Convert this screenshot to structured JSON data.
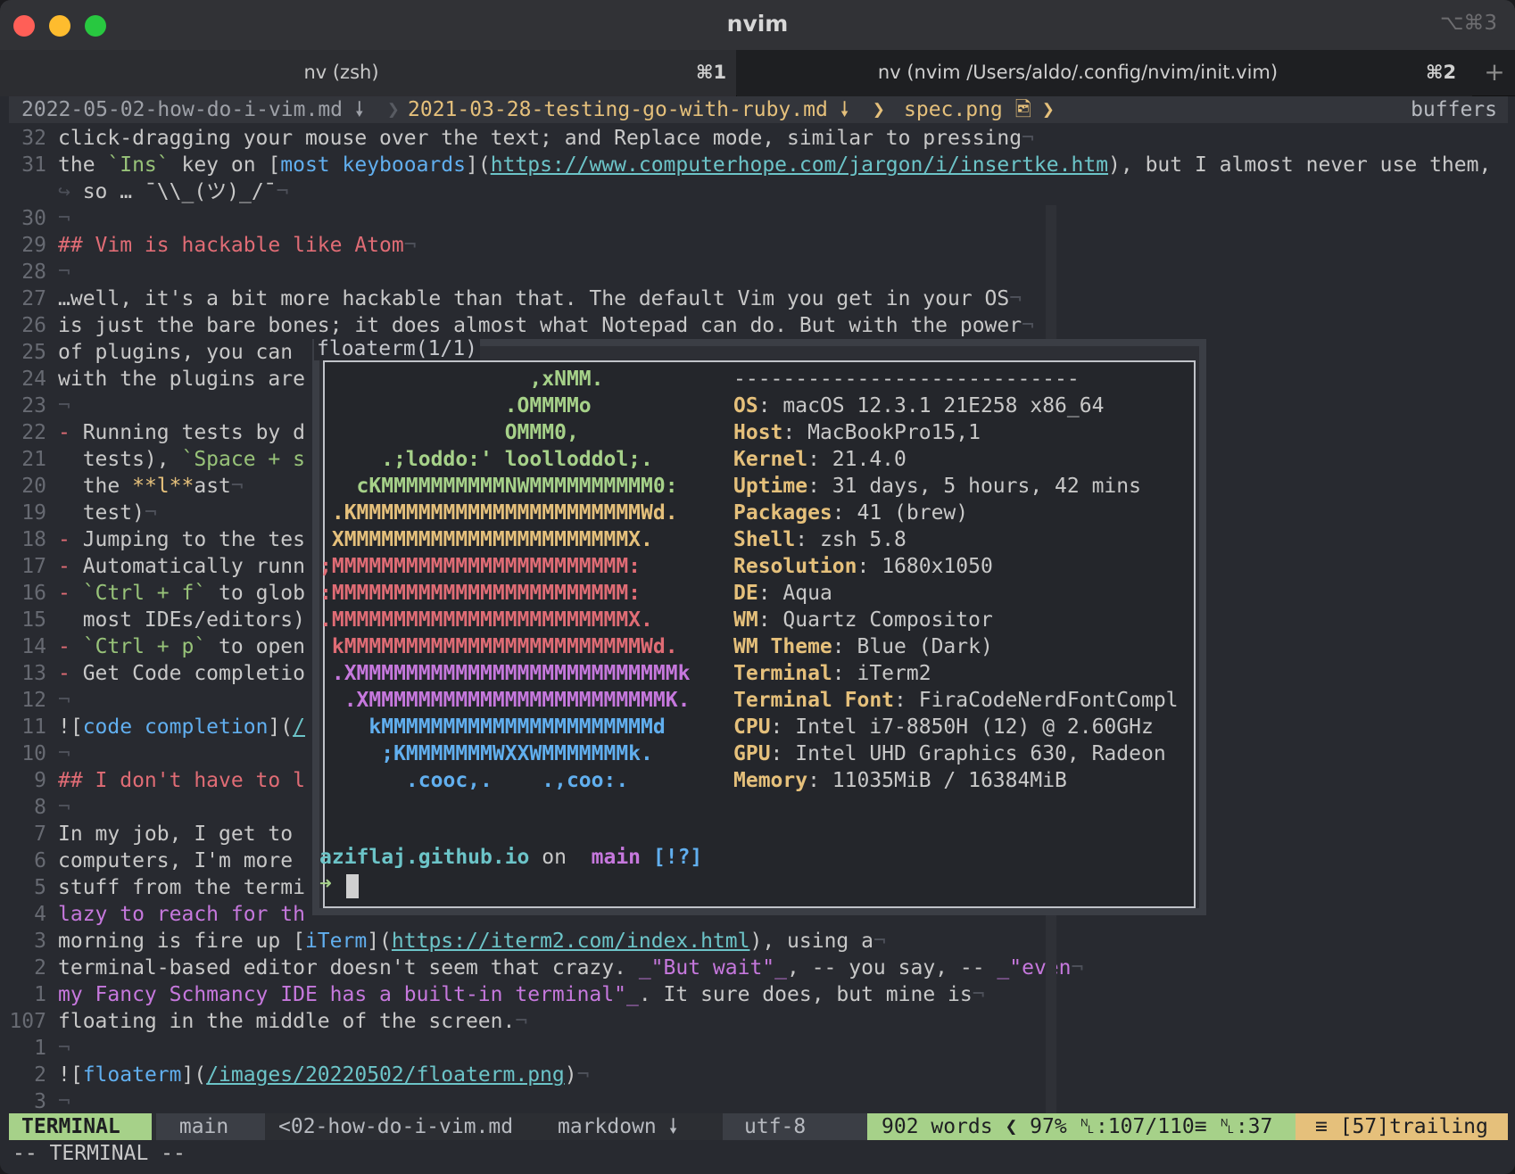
{
  "window": {
    "title": "nvim",
    "shortcut": "⌥⌘3"
  },
  "tabs": [
    {
      "label": "nv (zsh)",
      "key": "⌘1"
    },
    {
      "label": "nv (nvim /Users/aldo/.config/nvim/init.vim)",
      "key": "⌘2"
    }
  ],
  "tab_add": "+",
  "bufferline": {
    "buffers": [
      "2022-05-02-how-do-i-vim.md 🠗",
      "2021-03-28-testing-go-with-ruby.md 🠗",
      "spec.png 🖻"
    ],
    "label": "buffers"
  },
  "editor": {
    "lines": [
      {
        "n": "32",
        "html": "click-dragging your mouse over the text; and Replace mode, similar to pressing<span class=\"nl\">¬</span>"
      },
      {
        "n": "31",
        "html": "the <span class=\"code\">`Ins`</span> key on [<span class=\"link\">most keybooards</span>](<span class=\"url\">https://www.computerhope.com/jargon/i/insertke.htm</span>), but I almost never use them,"
      },
      {
        "n": "",
        "html": "<span class=\"nl\">↪</span> so … ¯\\\\_(ツ)_/¯<span class=\"nl\">¬</span>"
      },
      {
        "n": "30",
        "html": "<span class=\"nl\">¬</span>"
      },
      {
        "n": "29",
        "html": "<span class=\"h\">## Vim is hackable like Atom</span><span class=\"nl\">¬</span>"
      },
      {
        "n": "28",
        "html": "<span class=\"nl\">¬</span>"
      },
      {
        "n": "27",
        "html": "…well, it's a bit more hackable than that. The default Vim you get in your OS<span class=\"nl\">¬</span>"
      },
      {
        "n": "26",
        "html": "is just the bare bones; it does almost what Notepad can do. But with the power<span class=\"nl\">¬</span>"
      },
      {
        "n": "25",
        "html": "of plugins, you can"
      },
      {
        "n": "24",
        "html": "with the plugins are"
      },
      {
        "n": "23",
        "html": "<span class=\"nl\">¬</span>"
      },
      {
        "n": "22",
        "html": "<span class=\"h\">-</span> Running tests by d"
      },
      {
        "n": "21",
        "html": "  tests), <span class=\"code\">`Space + s</span>"
      },
      {
        "n": "20",
        "html": "  the <span class=\"bold\">**l**</span>ast<span class=\"nl\">¬</span>"
      },
      {
        "n": "19",
        "html": "  test)<span class=\"nl\">¬</span>"
      },
      {
        "n": "18",
        "html": "<span class=\"h\">-</span> Jumping to the tes"
      },
      {
        "n": "17",
        "html": "<span class=\"h\">-</span> Automatically runn"
      },
      {
        "n": "16",
        "html": "<span class=\"h\">-</span> <span class=\"code\">`Ctrl + f`</span> to glob"
      },
      {
        "n": "15",
        "html": "  most IDEs/editors)"
      },
      {
        "n": "14",
        "html": "<span class=\"h\">-</span> <span class=\"code\">`Ctrl + p`</span> to open"
      },
      {
        "n": "13",
        "html": "<span class=\"h\">-</span> Get Code completio"
      },
      {
        "n": "12",
        "html": "<span class=\"nl\">¬</span>"
      },
      {
        "n": "11",
        "html": "![<span class=\"link\">code completion</span>](<span class=\"url\">/</span>"
      },
      {
        "n": "10",
        "html": "<span class=\"nl\">¬</span>"
      },
      {
        "n": "9",
        "html": "<span class=\"h\">## I don't have to l</span>"
      },
      {
        "n": "8",
        "html": "<span class=\"nl\">¬</span>"
      },
      {
        "n": "7",
        "html": "In my job, I get to"
      },
      {
        "n": "6",
        "html": "computers, I'm more"
      },
      {
        "n": "5",
        "html": "stuff from the termi"
      },
      {
        "n": "4",
        "html": "<span class=\"mag\">lazy to reach for th</span>"
      },
      {
        "n": "3",
        "html": "morning is fire up [<span class=\"link\">iTerm</span>](<span class=\"url\">https://iterm2.com/index.html</span>), using a<span class=\"nl\">¬</span>"
      },
      {
        "n": "2",
        "html": "terminal-based editor doesn't seem that crazy. <span class=\"mag\">_\"But wait\"_</span>, -- you say, -- <span class=\"mag\">_\"even</span><span class=\"nl\">¬</span>"
      },
      {
        "n": "1",
        "html": "<span class=\"mag\">my Fancy Schmancy IDE has a built-in terminal\"_</span>. It sure does, but mine is<span class=\"nl\">¬</span>"
      },
      {
        "n": "107",
        "html": "floating in the middle of the screen.<span class=\"nl\">¬</span>"
      },
      {
        "n": "1",
        "html": "<span class=\"nl\">¬</span>"
      },
      {
        "n": "2",
        "html": "![<span class=\"link\">floaterm</span>](<span class=\"url\">/images/20220502/floaterm.png</span>)<span class=\"nl\">¬</span>"
      },
      {
        "n": "3",
        "html": "<span class=\"nl\">¬</span>"
      }
    ]
  },
  "floaterm": {
    "title": "floaterm(1/1)",
    "art": [
      {
        "t": "                 ,xNMM.",
        "c": "a-green"
      },
      {
        "t": "               .OMMMMo",
        "c": "a-green"
      },
      {
        "t": "               OMMM0,",
        "c": "a-green"
      },
      {
        "t": "     .;loddo:' loolloddol;.",
        "c": "a-green"
      },
      {
        "t": "   cKMMMMMMMMMMNWMMMMMMMMMM0:",
        "c": "a-green"
      },
      {
        "t": " .KMMMMMMMMMMMMMMMMMMMMMMMWd.",
        "c": "a-yellow"
      },
      {
        "t": " XMMMMMMMMMMMMMMMMMMMMMMMX.",
        "c": "a-yellow"
      },
      {
        "t": ";MMMMMMMMMMMMMMMMMMMMMMMM:",
        "c": "a-red"
      },
      {
        "t": ":MMMMMMMMMMMMMMMMMMMMMMMM:",
        "c": "a-red"
      },
      {
        "t": ".MMMMMMMMMMMMMMMMMMMMMMMMX.",
        "c": "a-red"
      },
      {
        "t": " kMMMMMMMMMMMMMMMMMMMMMMMMWd.",
        "c": "a-red"
      },
      {
        "t": " .XMMMMMMMMMMMMMMMMMMMMMMMMMMk",
        "c": "a-purple"
      },
      {
        "t": "  .XMMMMMMMMMMMMMMMMMMMMMMMMK.",
        "c": "a-purple"
      },
      {
        "t": "    kMMMMMMMMMMMMMMMMMMMMMMd",
        "c": "a-blue"
      },
      {
        "t": "     ;KMMMMMMMWXXWMMMMMMMk.",
        "c": "a-blue"
      },
      {
        "t": "       .cooc,.    .,coo:.",
        "c": "a-blue"
      }
    ],
    "separator": "----------------------------",
    "info": [
      {
        "k": "OS",
        "v": "macOS 12.3.1 21E258 x86_64"
      },
      {
        "k": "Host",
        "v": "MacBookPro15,1"
      },
      {
        "k": "Kernel",
        "v": "21.4.0"
      },
      {
        "k": "Uptime",
        "v": "31 days, 5 hours, 42 mins"
      },
      {
        "k": "Packages",
        "v": "41 (brew)"
      },
      {
        "k": "Shell",
        "v": "zsh 5.8"
      },
      {
        "k": "Resolution",
        "v": "1680x1050"
      },
      {
        "k": "DE",
        "v": "Aqua"
      },
      {
        "k": "WM",
        "v": "Quartz Compositor"
      },
      {
        "k": "WM Theme",
        "v": "Blue (Dark)"
      },
      {
        "k": "Terminal",
        "v": "iTerm2"
      },
      {
        "k": "Terminal Font",
        "v": "FiraCodeNerdFontCompl"
      },
      {
        "k": "CPU",
        "v": "Intel i7-8850H (12) @ 2.60GHz"
      },
      {
        "k": "GPU",
        "v": "Intel UHD Graphics 630, Radeon"
      },
      {
        "k": "Memory",
        "v": "11035MiB / 16384MiB"
      }
    ],
    "prompt": {
      "host": "aziflaj.github.io",
      "on": " on ",
      "branch_icon": "",
      "branch": " main",
      "state": " [!?]",
      "arrow": "➜"
    }
  },
  "statusline": {
    "mode": "TERMINAL",
    "branch": " main",
    "file": "<02-how-do-i-vim.md",
    "filetype": "markdown 🠗",
    "encoding": "utf-8 ",
    "words": "902 words ❮ 97% ␤:107/110≡ ␤:37",
    "trailing": "≡ [57]trailing"
  },
  "cmdline": "-- TERMINAL --"
}
